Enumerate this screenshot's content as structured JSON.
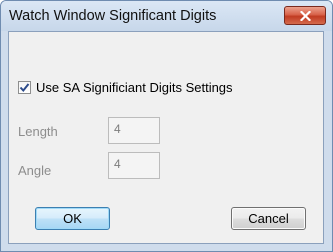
{
  "window": {
    "title": "Watch Window Significant Digits",
    "close_icon": "close-icon"
  },
  "options": {
    "use_sa_checkbox": {
      "label": "Use SA Significiant Digits Settings",
      "checked": true
    },
    "length": {
      "label": "Length",
      "value": "4"
    },
    "angle": {
      "label": "Angle",
      "value": "4"
    }
  },
  "buttons": {
    "ok_label": "OK",
    "cancel_label": "Cancel"
  },
  "colors": {
    "titlebar": "#cfdcec",
    "close_button": "#c94a30",
    "ok_border": "#3c7fb1",
    "checkmark": "#2b4a8a",
    "disabled_text": "#8d8d8d"
  }
}
